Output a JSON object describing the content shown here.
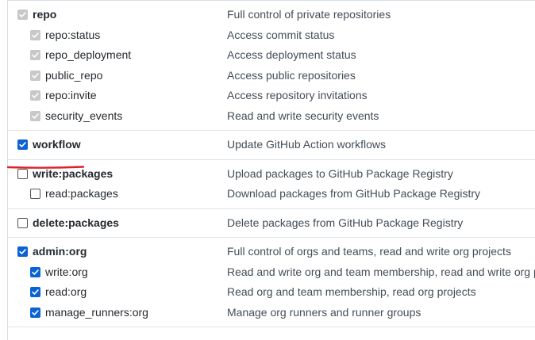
{
  "groups": [
    {
      "rows": [
        {
          "name": "repo",
          "desc": "Full control of private repositories",
          "level": "parent",
          "state": "disabled"
        },
        {
          "name": "repo:status",
          "desc": "Access commit status",
          "level": "child",
          "state": "disabled"
        },
        {
          "name": "repo_deployment",
          "desc": "Access deployment status",
          "level": "child",
          "state": "disabled"
        },
        {
          "name": "public_repo",
          "desc": "Access public repositories",
          "level": "child",
          "state": "disabled"
        },
        {
          "name": "repo:invite",
          "desc": "Access repository invitations",
          "level": "child",
          "state": "disabled"
        },
        {
          "name": "security_events",
          "desc": "Read and write security events",
          "level": "child",
          "state": "disabled"
        }
      ]
    },
    {
      "rows": [
        {
          "name": "workflow",
          "desc": "Update GitHub Action workflows",
          "level": "parent",
          "state": "checked"
        }
      ]
    },
    {
      "rows": [
        {
          "name": "write:packages",
          "desc": "Upload packages to GitHub Package Registry",
          "level": "parent",
          "state": "unchecked"
        },
        {
          "name": "read:packages",
          "desc": "Download packages from GitHub Package Registry",
          "level": "child",
          "state": "unchecked"
        }
      ]
    },
    {
      "rows": [
        {
          "name": "delete:packages",
          "desc": "Delete packages from GitHub Package Registry",
          "level": "parent",
          "state": "unchecked"
        }
      ]
    },
    {
      "rows": [
        {
          "name": "admin:org",
          "desc": "Full control of orgs and teams, read and write org projects",
          "level": "parent",
          "state": "checked"
        },
        {
          "name": "write:org",
          "desc": "Read and write org and team membership, read and write org projects",
          "level": "child",
          "state": "checked"
        },
        {
          "name": "read:org",
          "desc": "Read org and team membership, read org projects",
          "level": "child",
          "state": "checked"
        },
        {
          "name": "manage_runners:org",
          "desc": "Manage org runners and runner groups",
          "level": "child",
          "state": "checked"
        }
      ]
    }
  ],
  "colors": {
    "checked": "#0b62d6",
    "disabled": "#c8c8c8",
    "annotation": "#e0202a"
  }
}
